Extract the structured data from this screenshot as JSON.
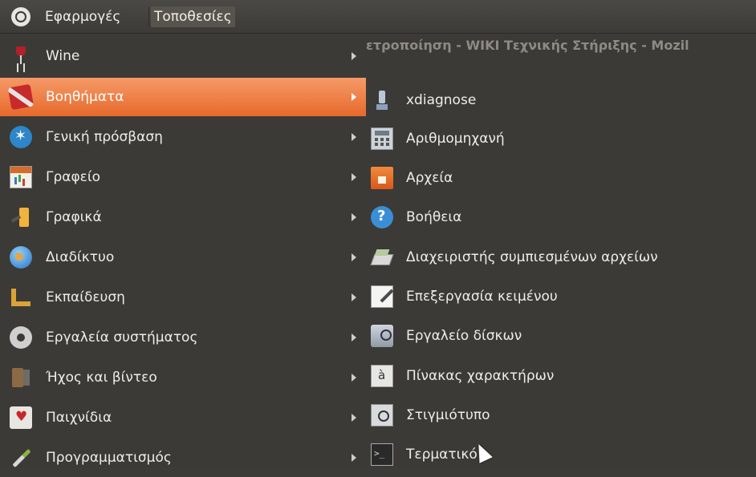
{
  "panel": {
    "applications_label": "Εφαρμογές",
    "places_label": "Τοποθεσίες"
  },
  "background_window_title": "ετροποίηση - WIKI Τεχνικής Στήριξης - Mozil",
  "menu": {
    "categories": [
      {
        "label": "Wine",
        "icon": "wine-icon"
      },
      {
        "label": "Βοηθήματα",
        "icon": "accessories-icon",
        "active": true
      },
      {
        "label": "Γενική πρόσβαση",
        "icon": "accessibility-icon"
      },
      {
        "label": "Γραφείο",
        "icon": "office-icon"
      },
      {
        "label": "Γραφικά",
        "icon": "graphics-icon"
      },
      {
        "label": "Διαδίκτυο",
        "icon": "internet-globe-icon"
      },
      {
        "label": "Εκπαίδευση",
        "icon": "education-icon"
      },
      {
        "label": "Εργαλεία συστήματος",
        "icon": "system-tools-gear-icon"
      },
      {
        "label": "Ήχος και βίντεο",
        "icon": "sound-video-icon"
      },
      {
        "label": "Παιχνίδια",
        "icon": "games-cards-icon"
      },
      {
        "label": "Προγραμματισμός",
        "icon": "programming-brush-icon"
      }
    ]
  },
  "submenu": {
    "items": [
      {
        "label": "xdiagnose",
        "icon": "xdiagnose-icon"
      },
      {
        "label": "Αριθμομηχανή",
        "icon": "calculator-icon"
      },
      {
        "label": "Αρχεία",
        "icon": "files-folder-icon"
      },
      {
        "label": "Βοήθεια",
        "icon": "help-icon"
      },
      {
        "label": "Διαχειριστής συμπιεσμένων αρχείων",
        "icon": "archive-manager-icon"
      },
      {
        "label": "Επεξεργασία κειμένου",
        "icon": "text-editor-icon"
      },
      {
        "label": "Εργαλείο δίσκων",
        "icon": "disks-icon"
      },
      {
        "label": "Πίνακας χαρακτήρων",
        "icon": "character-map-icon"
      },
      {
        "label": "Στιγμιότυπο",
        "icon": "screenshot-icon"
      },
      {
        "label": "Τερματικό",
        "icon": "terminal-icon"
      }
    ]
  },
  "colors": {
    "panel_bg": "#3c3b37",
    "menu_bg": "#3b3a36",
    "highlight": "#e7692b",
    "text": "#eeede8"
  }
}
